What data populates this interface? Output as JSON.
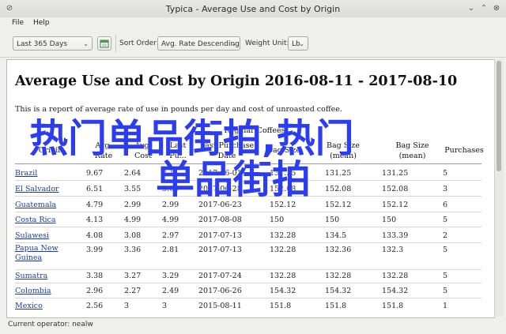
{
  "window": {
    "title": "Typica - Average Use and Cost by Origin"
  },
  "menu": [
    "File",
    "Help"
  ],
  "toolbar": {
    "date_range": "Last 365 Days",
    "sort_label": "Sort Order:",
    "sort_value": "Avg. Rate Descending",
    "weight_label": "Weight Unit:",
    "weight_value": "Lb"
  },
  "report": {
    "title": "Average Use and Cost by Origin 2016-08-11 - 2017-08-10",
    "description": "This is a report of average rate of use in pounds per day and cost of unroasted coffee.",
    "group_header": "Regular Coffees",
    "columns": [
      "Origin",
      "Avg. Rate",
      "Avg. Cost",
      "Last Purchase",
      "Last Purchase Date",
      "Bag Size (mean)",
      "Bag Size (mean)",
      "Bag Size (mean)",
      "Purchases"
    ],
    "column_labels": {
      "origin": "Origin",
      "avg_rate": "Avg.\nRate",
      "avg_cost": "Avg.\nCost",
      "last": "Last\nPu...",
      "last_purchase": "Last Purchase\nDate",
      "bag_a": "Bag Size",
      "bag_b": "Bag Size\n(mean)",
      "bag_size": "Bag Size\n(mean)",
      "purchases": "Purchases"
    },
    "rows": [
      {
        "origin": "Brazil",
        "rate": "9.67",
        "cost": "2.64",
        "last": "3.1",
        "date": "2017-06-01",
        "b1": "131.25",
        "b2": "131.25",
        "b3": "131.25",
        "purchases": "5"
      },
      {
        "origin": "El Salvador",
        "rate": "6.51",
        "cost": "3.55",
        "last": "3.65",
        "date": "2017-06-28",
        "b1": "152.08",
        "b2": "152.08",
        "b3": "152.08",
        "purchases": "3"
      },
      {
        "origin": "Guatemala",
        "rate": "4.79",
        "cost": "2.99",
        "last": "2.99",
        "date": "2017-06-23",
        "b1": "152.12",
        "b2": "152.12",
        "b3": "152.12",
        "purchases": "6"
      },
      {
        "origin": "Costa Rica",
        "rate": "4.13",
        "cost": "4.99",
        "last": "4.99",
        "date": "2017-08-08",
        "b1": "150",
        "b2": "150",
        "b3": "150",
        "purchases": "5"
      },
      {
        "origin": "Sulawesi",
        "rate": "4.08",
        "cost": "3.08",
        "last": "2.97",
        "date": "2017-07-13",
        "b1": "132.28",
        "b2": "134.5",
        "b3": "133.39",
        "purchases": "2"
      },
      {
        "origin": "Papua New Guinea",
        "rate": "3.99",
        "cost": "3.36",
        "last": "2.81",
        "date": "2017-07-13",
        "b1": "132.28",
        "b2": "132.36",
        "b3": "132.3",
        "purchases": "5"
      },
      {
        "origin": "Sumatra",
        "rate": "3.38",
        "cost": "3.27",
        "last": "3.29",
        "date": "2017-07-24",
        "b1": "132.28",
        "b2": "132.28",
        "b3": "132.28",
        "purchases": "5"
      },
      {
        "origin": "Colombia",
        "rate": "2.96",
        "cost": "2.27",
        "last": "2.49",
        "date": "2017-06-26",
        "b1": "154.32",
        "b2": "154.32",
        "b3": "154.32",
        "purchases": "5"
      },
      {
        "origin": "Mexico",
        "rate": "2.56",
        "cost": "3",
        "last": "3",
        "date": "2015-08-11",
        "b1": "151.8",
        "b2": "151.8",
        "b3": "151.8",
        "purchases": "1"
      }
    ]
  },
  "overlay": {
    "line1": "热门单品街拍,热门",
    "line2": "单品街拍"
  },
  "status": "Current operator: nealw"
}
